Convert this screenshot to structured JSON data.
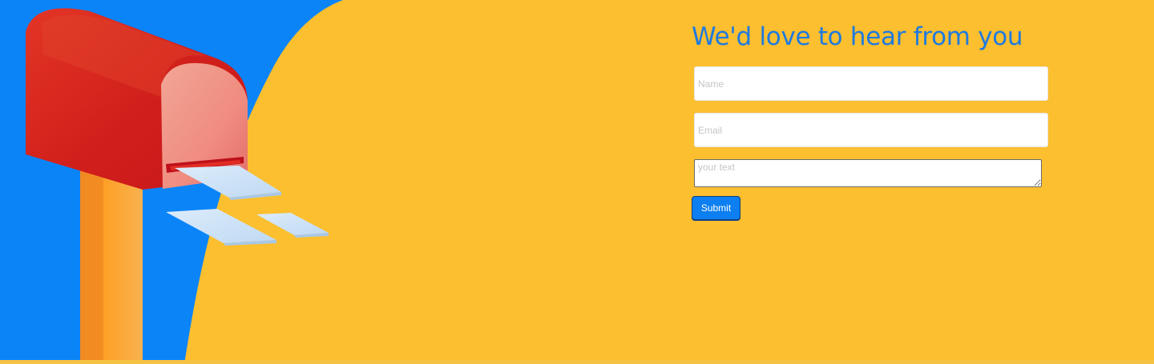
{
  "contact": {
    "title": "We'd love to hear from you",
    "name_placeholder": "Name",
    "email_placeholder": "Email",
    "message_placeholder": "your text",
    "submit_label": "Submit"
  },
  "colors": {
    "background": "#fbbf2f",
    "blue_shape": "#0b84f8",
    "title": "#1f7ae0",
    "button": "#0d7ff0",
    "mailbox_red": "#d7221f",
    "mailbox_pink": "#f4a090",
    "post_orange": "#fe9f24",
    "letters": "#c8e0f6"
  },
  "illustration": {
    "name": "mailbox-illustration"
  }
}
